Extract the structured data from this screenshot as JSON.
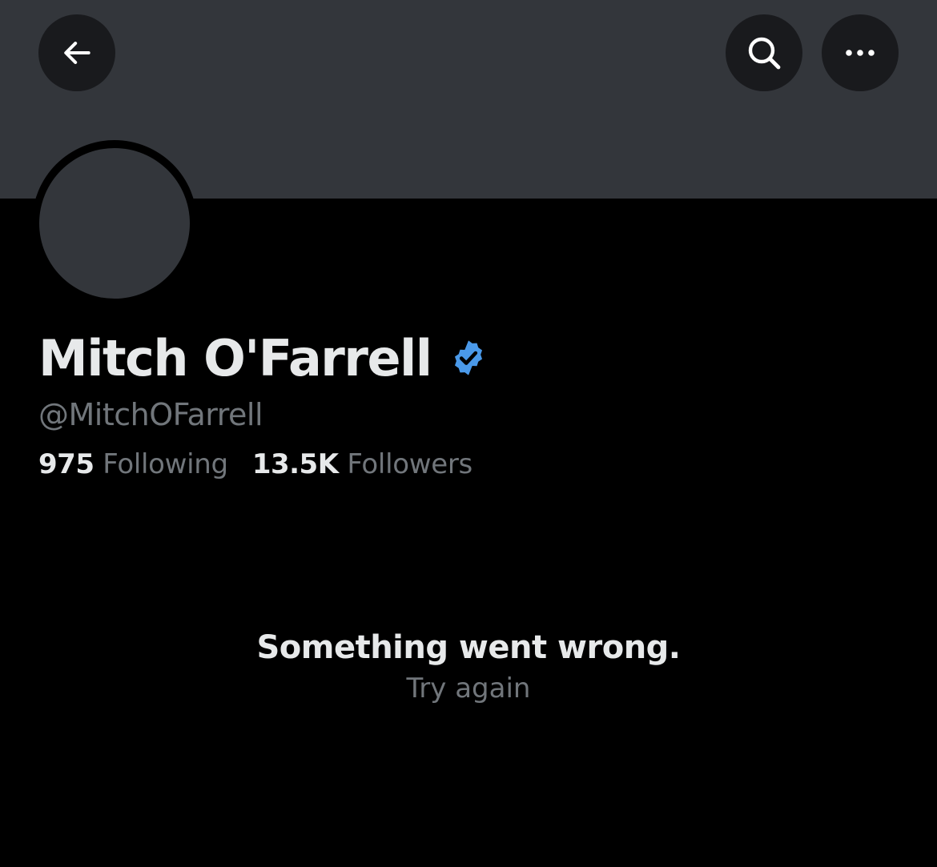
{
  "header": {
    "back_icon": "arrow-left-icon",
    "search_icon": "search-icon",
    "more_icon": "more-horizontal-icon"
  },
  "profile": {
    "display_name": "Mitch O'Farrell",
    "verified": true,
    "handle": "@MitchOFarrell",
    "following_count": "975",
    "following_label": "Following",
    "followers_count": "13.5K",
    "followers_label": "Followers"
  },
  "error": {
    "title": "Something went wrong.",
    "retry_label": "Try again"
  },
  "colors": {
    "background": "#000000",
    "banner": "#33363b",
    "button_bg": "#191a1d",
    "primary_text": "#e7e9ea",
    "secondary_text": "#71767b",
    "verified_blue": "#4a99e9"
  }
}
